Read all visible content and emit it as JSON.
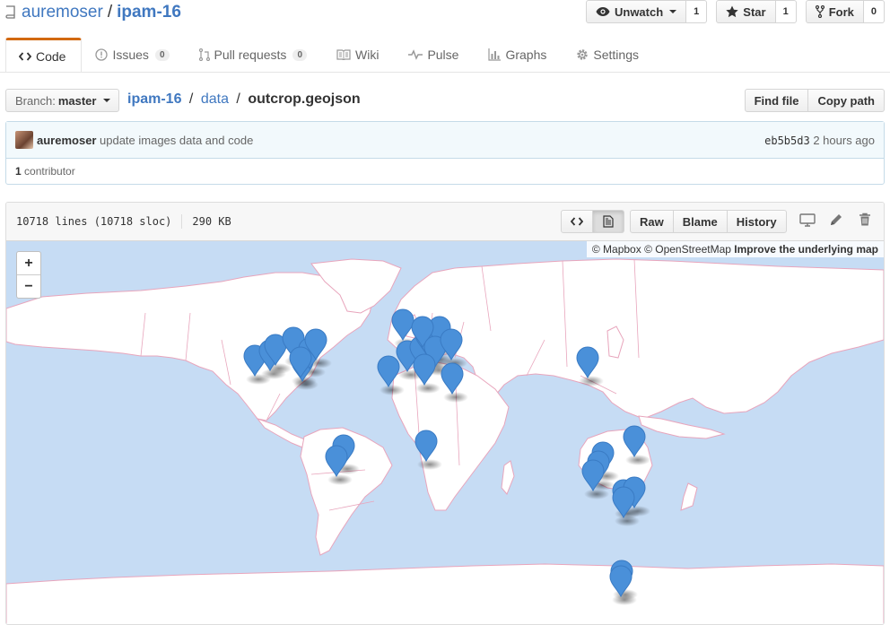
{
  "repo": {
    "owner": "auremoser",
    "name": "ipam-16"
  },
  "actions": [
    {
      "label": "Unwatch",
      "count": "1"
    },
    {
      "label": "Star",
      "count": "1"
    },
    {
      "label": "Fork",
      "count": "0"
    }
  ],
  "tabs": [
    {
      "label": "Code"
    },
    {
      "label": "Issues",
      "count": "0"
    },
    {
      "label": "Pull requests",
      "count": "0"
    },
    {
      "label": "Wiki"
    },
    {
      "label": "Pulse"
    },
    {
      "label": "Graphs"
    },
    {
      "label": "Settings"
    }
  ],
  "branch": {
    "prefix": "Branch:",
    "name": "master"
  },
  "breadcrumb": {
    "root": "ipam-16",
    "dir": "data",
    "file": "outcrop.geojson"
  },
  "path_buttons": {
    "find": "Find file",
    "copy": "Copy path"
  },
  "commit": {
    "author": "auremoser",
    "message": "update images data and code",
    "sha": "eb5b5d3",
    "time": "2 hours ago",
    "contributors_count": "1",
    "contributors_label": "contributor"
  },
  "file": {
    "lines": "10718 lines (10718 sloc)",
    "size": "290 KB",
    "raw": "Raw",
    "blame": "Blame",
    "history": "History"
  },
  "map": {
    "zoom_in": "+",
    "zoom_out": "−",
    "attribution_mapbox": "© Mapbox",
    "attribution_osm": "© OpenStreetMap",
    "attribution_improve": "Improve the underlying map",
    "marker_color": "#4a90d9",
    "water_color": "#c6dcf4",
    "land_color": "#ffffff",
    "border_color": "#e8a5bc"
  }
}
